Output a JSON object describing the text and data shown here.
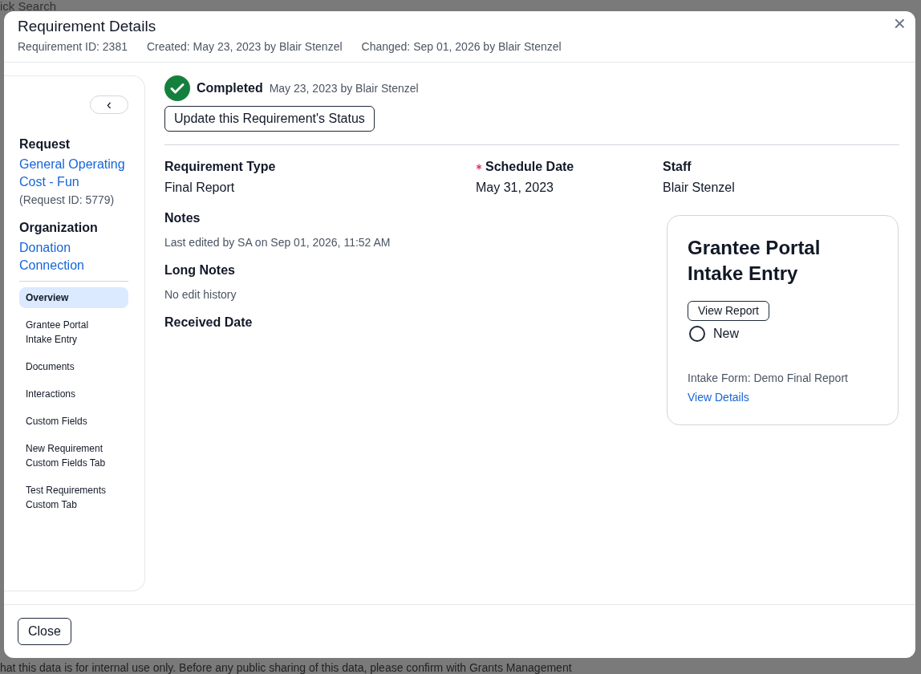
{
  "background": {
    "top_text": "ick Search",
    "bottom_notice": "hat this data is for internal use only. Before any public sharing of this data, please confirm with Grants Management"
  },
  "dialog": {
    "title": "Requirement Details",
    "close": "×",
    "meta": [
      "Requirement ID: 2381",
      "Created: May 23, 2023 by Blair Stenzel",
      "Changed: Sep 01, 2026 by Blair Stenzel"
    ],
    "footer_button": "Close"
  },
  "sidebar": {
    "collapse": "‹",
    "request": {
      "heading": "Request",
      "link": "General Operating Cost - Fun",
      "note": "(Request ID: 5779)"
    },
    "organization": {
      "heading": "Organization",
      "link": "Donation Connection"
    },
    "items": [
      {
        "label": "Overview",
        "selected": true
      },
      {
        "label": "Grantee Portal Intake Entry",
        "selected": false
      },
      {
        "label": "Documents",
        "selected": false
      },
      {
        "label": "Interactions",
        "selected": false
      },
      {
        "label": "Custom Fields",
        "selected": false
      },
      {
        "label": "New Requirement Custom Fields Tab",
        "selected": false
      },
      {
        "label": "Test Requirements Custom Tab",
        "selected": false
      }
    ]
  },
  "status": {
    "label": "Completed",
    "done": true,
    "detail": "May 23, 2023 by Blair Stenzel",
    "button": "Update this Requirement's Status"
  },
  "fields": [
    {
      "label": "Requirement Type",
      "value": "Final Report",
      "required": false
    },
    {
      "label": "Schedule Date",
      "value": "May 31, 2023",
      "required": true
    },
    {
      "label": "Staff",
      "value": "Blair Stenzel",
      "required": false
    }
  ],
  "notes": [
    {
      "label": "Notes",
      "detail": "Last edited by SA on Sep 01, 2026, 11:52 AM"
    },
    {
      "label": "Long Notes",
      "detail": "No edit history"
    },
    {
      "label": "Received Date"
    }
  ],
  "intake_card": {
    "title": "Grantee Portal Intake Entry",
    "button": "View Report",
    "status": "New",
    "status_checked": false,
    "form": "Intake Form: Demo Final Report",
    "link": "View Details"
  }
}
